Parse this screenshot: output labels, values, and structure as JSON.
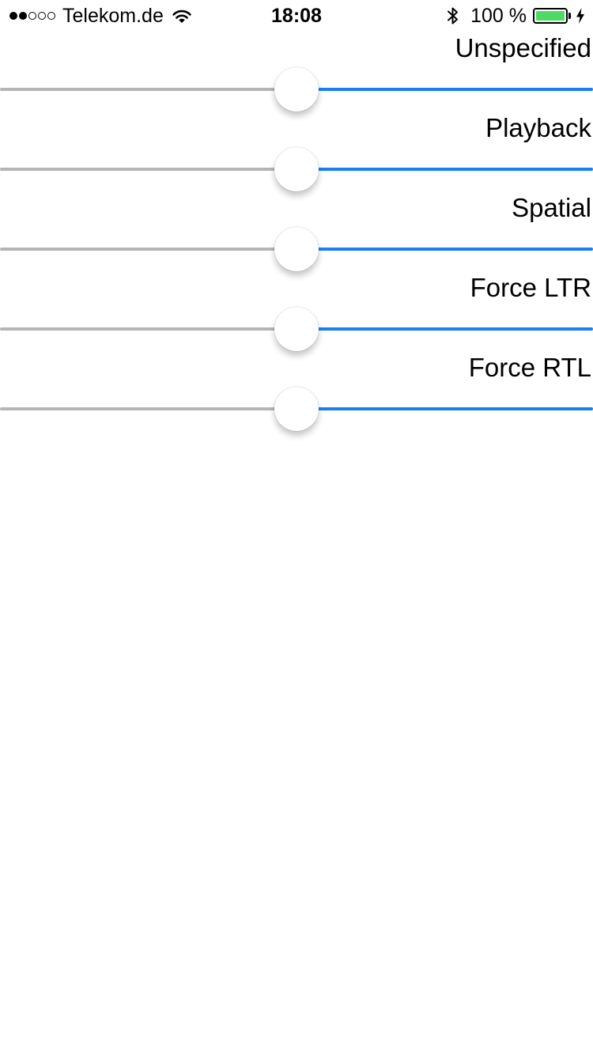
{
  "status_bar": {
    "signal_bars_filled": 2,
    "signal_bars_total": 5,
    "carrier": "Telekom.de",
    "time": "18:08",
    "battery_percent_label": "100 %",
    "battery_level": 1.0,
    "battery_color": "#4cd964",
    "icons": [
      "wifi-icon",
      "bluetooth-icon",
      "battery-icon",
      "charging-bolt-icon"
    ]
  },
  "colors": {
    "min_track": "#b5b5b5",
    "max_track": "#1a7ff0",
    "thumb": "#ffffff"
  },
  "sliders": [
    {
      "label": "Unspecified",
      "value": 0.5
    },
    {
      "label": "Playback",
      "value": 0.5
    },
    {
      "label": "Spatial",
      "value": 0.5
    },
    {
      "label": "Force LTR",
      "value": 0.5
    },
    {
      "label": "Force RTL",
      "value": 0.5
    }
  ]
}
